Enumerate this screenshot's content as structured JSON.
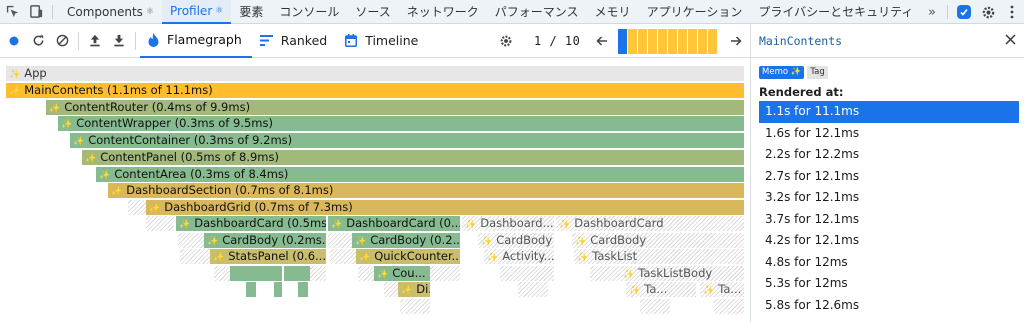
{
  "devtools_tabs": [
    {
      "label": "Components",
      "gem": "⚛",
      "active": false
    },
    {
      "label": "Profiler",
      "gem": "⚛",
      "active": true
    },
    {
      "label": "要素",
      "gem": "",
      "active": false
    },
    {
      "label": "コンソール",
      "gem": "",
      "active": false
    },
    {
      "label": "ソース",
      "gem": "",
      "active": false
    },
    {
      "label": "ネットワーク",
      "gem": "",
      "active": false
    },
    {
      "label": "パフォーマンス",
      "gem": "",
      "active": false
    },
    {
      "label": "メモリ",
      "gem": "",
      "active": false
    },
    {
      "label": "アプリケーション",
      "gem": "",
      "active": false
    },
    {
      "label": "プライバシーとセキュリティ",
      "gem": "",
      "active": false
    }
  ],
  "more_tabs": "»",
  "toolbar": {
    "flamegraph": "Flamegraph",
    "ranked": "Ranked",
    "timeline": "Timeline",
    "commit_counter": "1 / 10",
    "commit_bar_levels": [
      0.95,
      0.95,
      0.95,
      0.95,
      0.95,
      0.95,
      0.95,
      0.95,
      0.95,
      0.95
    ]
  },
  "flamegraph": {
    "root": "App",
    "rows": [
      "MainContents (1.1ms of 11.1ms)",
      "ContentRouter (0.4ms of 9.9ms)",
      "ContentWrapper (0.3ms of 9.5ms)",
      "ContentContainer (0.3ms of 9.2ms)",
      "ContentPanel (0.5ms of 8.9ms)",
      "ContentArea (0.3ms of 8.4ms)",
      "DashboardSection (0.7ms of 8.1ms)",
      "DashboardGrid (0.7ms of 7.3ms)"
    ],
    "dashboard_card_1": "DashboardCard (0.5ms...",
    "dashboard_card_2": "DashboardCard (0....",
    "dashboard_card_3": "Dashboard...",
    "dashboard_card_4": "DashboardCard",
    "cardbody_1": "CardBody (0.2ms...",
    "cardbody_2": "CardBody (0.2...",
    "cardbody_3": "CardBody",
    "cardbody_4": "CardBody",
    "statspanel": "StatsPanel (0.6...",
    "quickcounter": "QuickCounter...",
    "activity": "Activity...",
    "tasklist": "TaskList",
    "counter": "Cou...",
    "tasklistbody": "TaskListBody",
    "di": "Di...",
    "ta1": "Ta...",
    "ta2": "Ta..."
  },
  "sidebar": {
    "component_name": "MainContents",
    "badge_memo": "Memo ✨",
    "badge_tag": "Tag",
    "rendered_at_label": "Rendered at:",
    "renders": [
      "1.1s for 11.1ms",
      "1.6s for 12.1ms",
      "2.2s for 12.2ms",
      "2.7s for 12.1ms",
      "3.2s for 12.1ms",
      "3.7s for 12.1ms",
      "4.2s for 12.1ms",
      "4.8s for 12ms",
      "5.3s for 12ms",
      "5.8s for 12.6ms"
    ]
  },
  "colors": {
    "accent": "#1a73e8",
    "flame_yellow": "#ffbd2e",
    "flame_green": "#86bb92",
    "flame_olive": "#c9bd6e",
    "flame_gold": "#d9b85c"
  }
}
